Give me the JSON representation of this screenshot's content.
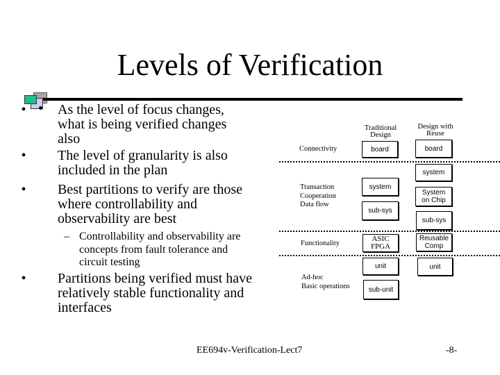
{
  "slide": {
    "title": "Levels of Verification",
    "bullets": [
      {
        "marker": "•",
        "lines": [
          "As the level of focus changes,",
          "what is being verified changes",
          "also"
        ]
      },
      {
        "marker": "•",
        "lines": [
          "The level of granularity is also",
          "included in the plan"
        ]
      },
      {
        "marker": "•",
        "lines": [
          "Best partitions to verify are those",
          "where controllability and",
          "observability are best"
        ]
      }
    ],
    "sub_bullet": {
      "marker": "–",
      "lines": [
        "Controllability and observability are",
        "concepts from fault tolerance and",
        "circuit testing"
      ]
    },
    "last_bullet": {
      "marker": "•",
      "lines": [
        "Partitions being verified must have",
        "relatively stable functionality and",
        "interfaces"
      ]
    },
    "footer": "EE694v-Verification-Lect7",
    "page_number": "-8-",
    "colors": {
      "logo_teal": "#1fc08e",
      "logo_gray": "#a6a6a6",
      "logo_lavender": "#ccccf2"
    }
  },
  "diagram": {
    "headers": {
      "traditional": [
        "Traditional",
        "Design"
      ],
      "reuse": [
        "Design with",
        "Reuse"
      ]
    },
    "levels": {
      "connectivity": [
        "Connectivity"
      ],
      "transaction": [
        "Transaction",
        "Cooperation",
        "Data flow"
      ],
      "functionality": [
        "Functionality"
      ],
      "adhoc": [
        "Ad-hoc",
        "Basic operations"
      ]
    },
    "traditional_boxes": {
      "board": "board",
      "system": "system",
      "subsys": "sub-sys",
      "asic": [
        "ASIC",
        "FPGA"
      ],
      "unit": "unit",
      "subunit": "sub-unit"
    },
    "reuse_boxes": {
      "board": "board",
      "system": "system",
      "soc": [
        "System",
        "on Chip"
      ],
      "subsys": "sub-sys",
      "reusable": [
        "Reusable",
        "Comp"
      ],
      "unit": "unit"
    }
  }
}
